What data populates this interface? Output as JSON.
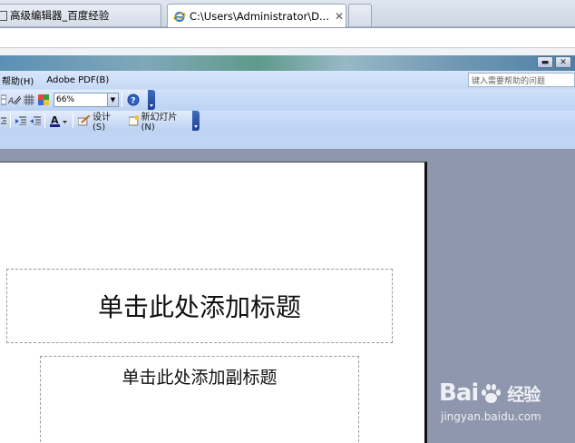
{
  "browser": {
    "tabs": [
      {
        "label": "高级编辑器_百度经验",
        "active": false
      },
      {
        "label": "C:\\Users\\Administrator\\D...",
        "active": true,
        "close": "✕"
      }
    ]
  },
  "office": {
    "menu": [
      "帮助(H)",
      "Adobe PDF(B)"
    ],
    "help_placeholder": "键入需要帮助的问题",
    "toolbar": {
      "zoom": "66%",
      "design_label": "设计(S)",
      "new_slide_label": "新幻灯片(N)"
    }
  },
  "slide": {
    "title_placeholder": "单击此处添加标题",
    "subtitle_placeholder": "单击此处添加副标题"
  },
  "watermark": {
    "brand_left": "Bai",
    "brand_right": "经验",
    "url": "jingyan.baidu.com"
  },
  "colors": {
    "workspace": "#8e97ad",
    "toolbar": "#c6daf6",
    "toolbar_grip": "#1d4292"
  }
}
